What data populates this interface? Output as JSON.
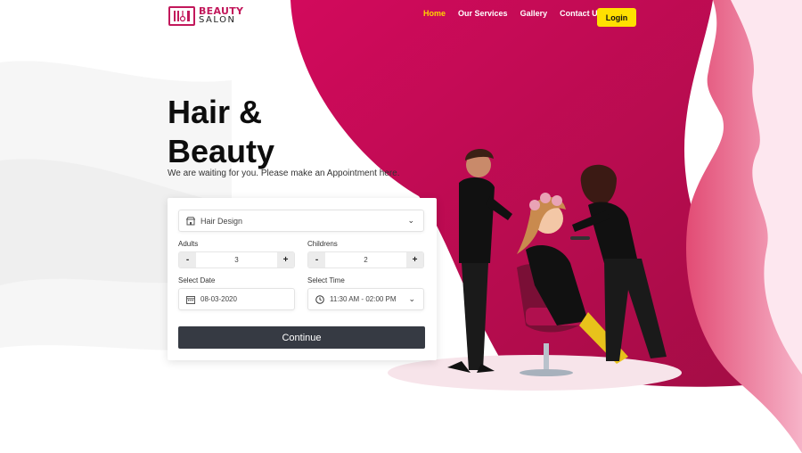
{
  "logo": {
    "line1": "BEAUTY",
    "line2": "SALON",
    "icon": "scissors-comb-icon"
  },
  "nav": {
    "items": [
      "Home",
      "Our Services",
      "Gallery",
      "Contact Us"
    ],
    "active": "Home",
    "login_label": "Login"
  },
  "hero": {
    "title_line1": "Hair &",
    "title_line2": "Beauty",
    "subtitle": "We are waiting for you. Please make an Appointment here."
  },
  "form": {
    "service": {
      "value": "Hair Design",
      "icon": "store-icon"
    },
    "adults": {
      "label": "Adults",
      "value": "3",
      "minus": "-",
      "plus": "+"
    },
    "childrens": {
      "label": "Childrens",
      "value": "2",
      "minus": "-",
      "plus": "+"
    },
    "date": {
      "label": "Select Date",
      "value": "08-03-2020",
      "icon": "calendar-icon"
    },
    "time": {
      "label": "Select Time",
      "value": "11:30 AM - 02:00 PM",
      "icon": "clock-icon"
    },
    "continue_label": "Continue"
  },
  "colors": {
    "accent": "#c2185b",
    "active_nav": "#ffd400",
    "login_bg": "#ffe000",
    "button_dark": "#363a43"
  }
}
